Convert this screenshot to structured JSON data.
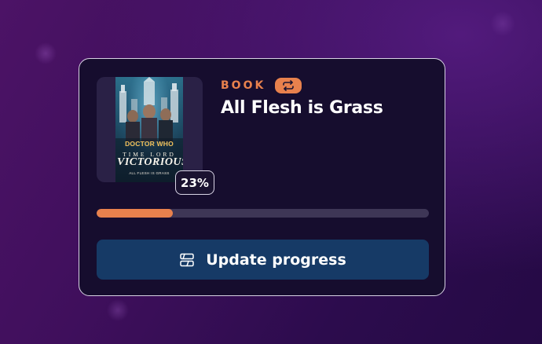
{
  "card": {
    "media_type": "BOOK",
    "title": "All Flesh is Grass",
    "progress_percent_label": "23%",
    "progress_fraction": 0.23,
    "update_button_label": "Update progress",
    "cover": {
      "brand": "DOCTOR WHO",
      "series_top": "TIME LORD",
      "series_main": "VICTORIOUS",
      "subtitle": "ALL FLESH IS GRASS"
    }
  },
  "colors": {
    "accent": "#e8814d",
    "button": "#163a66",
    "card_bg": "#160d2e",
    "track": "#3e3656"
  },
  "icons": {
    "repeat": "repeat-icon",
    "update": "progress-edit-icon"
  }
}
